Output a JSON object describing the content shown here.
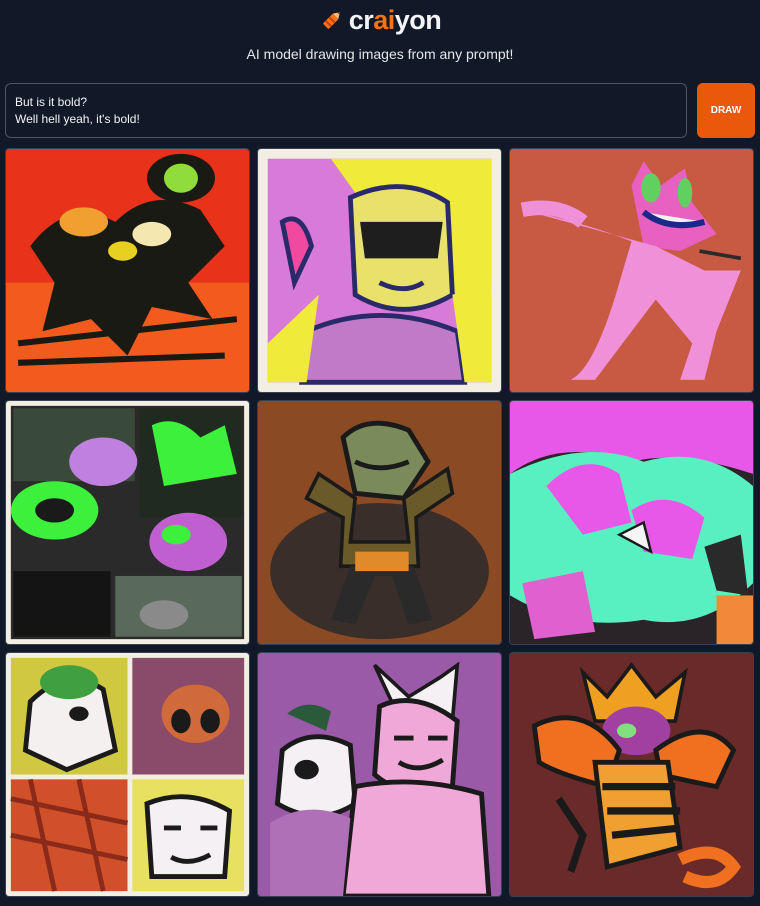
{
  "header": {
    "brand_prefix": "cr",
    "brand_accent": "ai",
    "brand_suffix": "yon",
    "subtitle": "AI model drawing images from any prompt!",
    "logo_icon": "crayon-icon"
  },
  "prompt": {
    "line1": "But is it bold?",
    "line2": "Well hell yeah, it's bold!"
  },
  "draw_button": {
    "label": "DRAW"
  },
  "colors": {
    "background": "#111827",
    "accent": "#ea580c",
    "border": "#4b5563"
  },
  "images": [
    {
      "name": "generated-image-1"
    },
    {
      "name": "generated-image-2"
    },
    {
      "name": "generated-image-3"
    },
    {
      "name": "generated-image-4"
    },
    {
      "name": "generated-image-5"
    },
    {
      "name": "generated-image-6"
    },
    {
      "name": "generated-image-7"
    },
    {
      "name": "generated-image-8"
    },
    {
      "name": "generated-image-9"
    }
  ]
}
